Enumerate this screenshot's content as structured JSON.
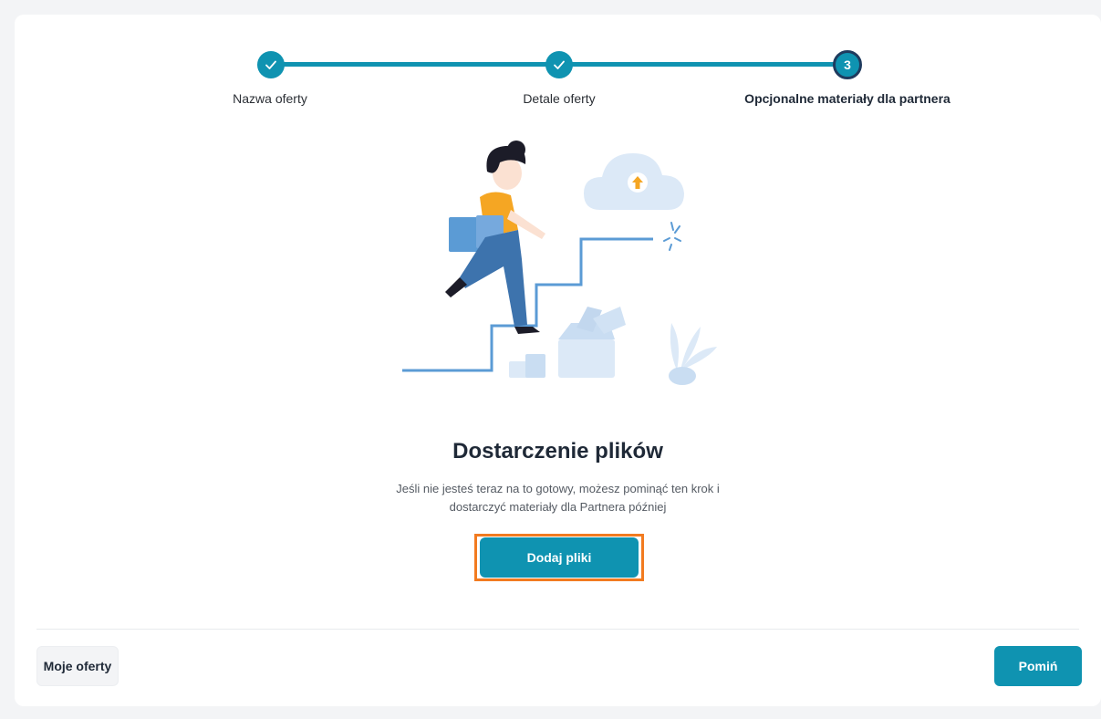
{
  "stepper": {
    "steps": [
      {
        "label": "Nazwa oferty",
        "state": "completed",
        "icon": "check-icon"
      },
      {
        "label": "Detale oferty",
        "state": "completed",
        "icon": "check-icon"
      },
      {
        "label": "Opcjonalne materiały dla partnera",
        "state": "current",
        "number": "3"
      }
    ]
  },
  "main": {
    "title": "Dostarczenie plików",
    "description": "Jeśli nie jesteś teraz na to gotowy, możesz pominąć ten krok i dostarczyć materiały dla Partnera później",
    "add_files_label": "Dodaj pliki"
  },
  "footer": {
    "my_offers_label": "Moje oferty",
    "skip_label": "Pomiń"
  },
  "colors": {
    "accent": "#0f93b1",
    "focus_outline": "#f27b20",
    "illustration_blue": "#5b9bd5",
    "illustration_orange": "#f5a623"
  }
}
